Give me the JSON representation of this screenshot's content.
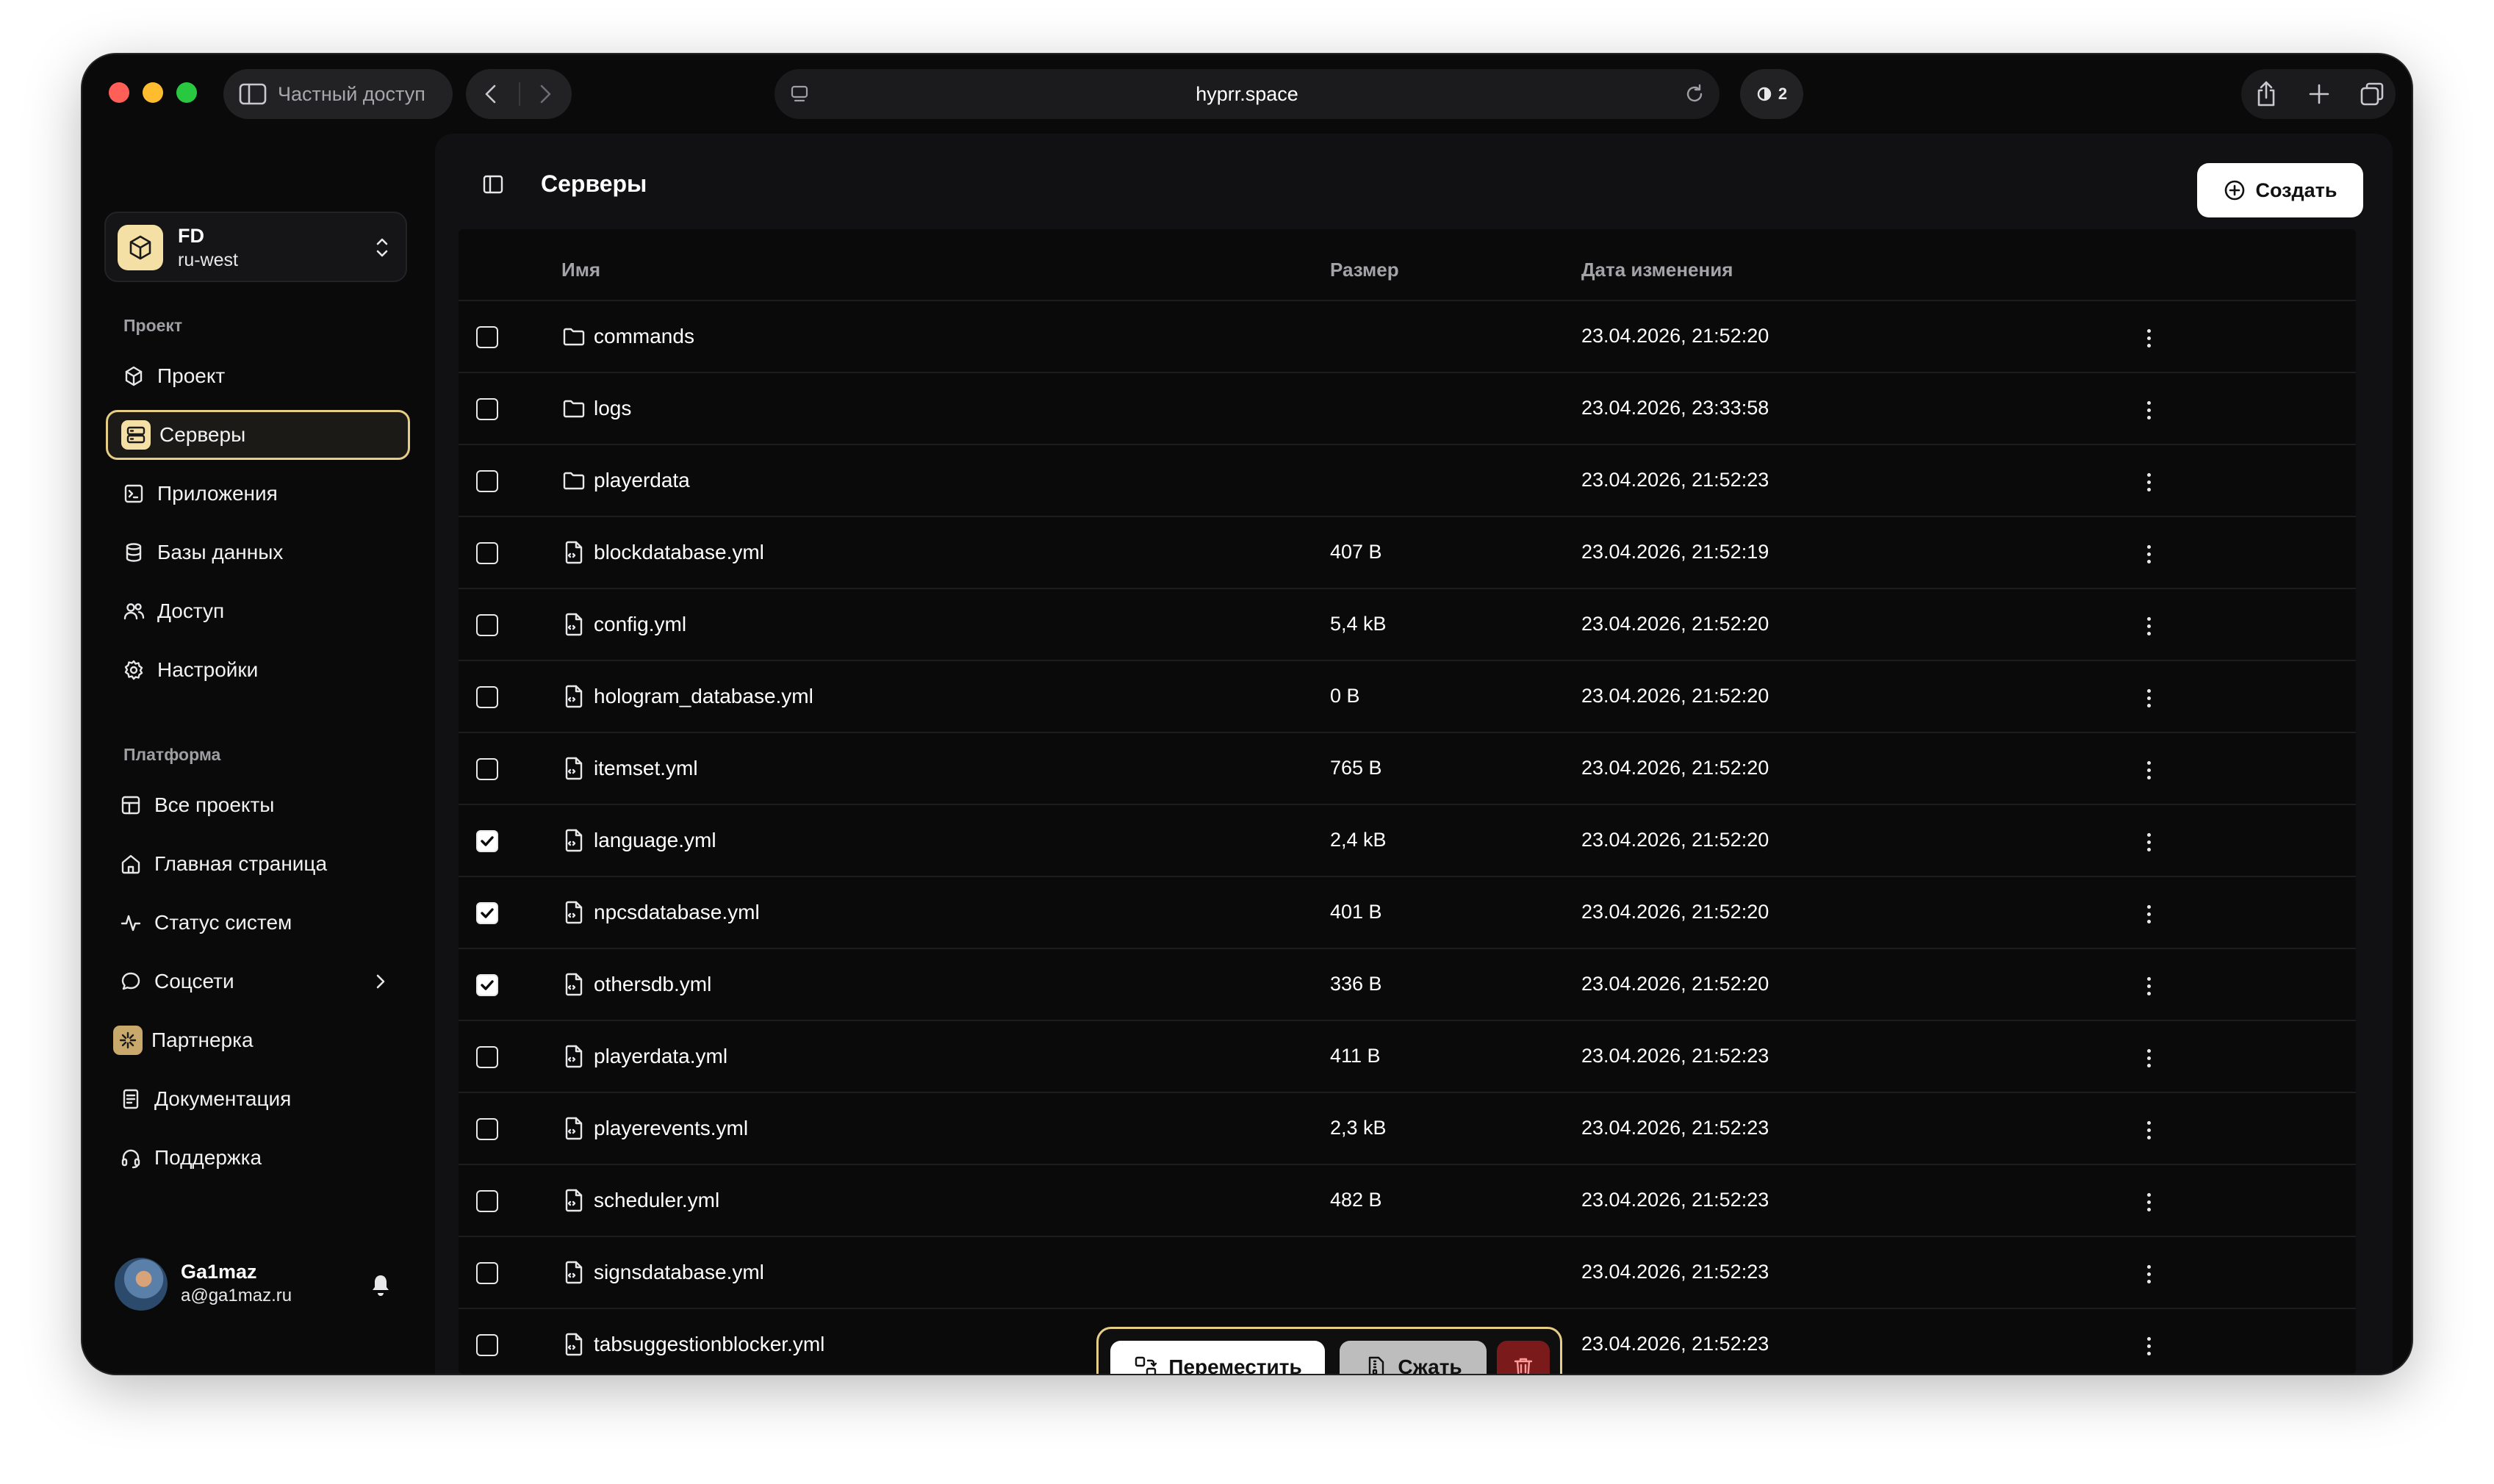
{
  "colors": {
    "accent": "#e6cd85",
    "accent_fill": "#f4dfa4",
    "danger": "#7a1a1a",
    "traffic_red": "#ff5f57",
    "traffic_yellow": "#febc2e",
    "traffic_green": "#28c840"
  },
  "browser": {
    "private_label": "Частный доступ",
    "url": "hyprr.space",
    "extension_badge": "2"
  },
  "sidebar": {
    "project": {
      "name": "FD",
      "region": "ru-west"
    },
    "section_project": "Проект",
    "project_items": [
      {
        "label": "Проект",
        "icon": "cube-icon"
      },
      {
        "label": "Серверы",
        "icon": "server-icon",
        "active": true
      },
      {
        "label": "Приложения",
        "icon": "terminal-window-icon"
      },
      {
        "label": "Базы данных",
        "icon": "database-icon"
      },
      {
        "label": "Доступ",
        "icon": "users-icon"
      },
      {
        "label": "Настройки",
        "icon": "gear-icon"
      }
    ],
    "section_platform": "Платформа",
    "platform_items": [
      {
        "label": "Все проекты",
        "icon": "grid-icon"
      },
      {
        "label": "Главная страница",
        "icon": "home-icon"
      },
      {
        "label": "Статус систем",
        "icon": "activity-icon"
      },
      {
        "label": "Соцсети",
        "icon": "chat-bubble-icon"
      },
      {
        "label": "Партнерка",
        "icon": "partner-icon"
      },
      {
        "label": "Документация",
        "icon": "document-icon"
      },
      {
        "label": "Поддержка",
        "icon": "headset-icon"
      }
    ],
    "user": {
      "name": "Ga1maz",
      "email": "a@ga1maz.ru"
    }
  },
  "main": {
    "title": "Серверы",
    "create_label": "Создать",
    "columns": {
      "name": "Имя",
      "size": "Размер",
      "modified": "Дата изменения"
    },
    "rows": [
      {
        "name": "commands",
        "type": "folder",
        "size": "",
        "modified": "23.04.2026, 21:52:20",
        "checked": false
      },
      {
        "name": "logs",
        "type": "folder",
        "size": "",
        "modified": "23.04.2026, 23:33:58",
        "checked": false
      },
      {
        "name": "playerdata",
        "type": "folder",
        "size": "",
        "modified": "23.04.2026, 21:52:23",
        "checked": false
      },
      {
        "name": "blockdatabase.yml",
        "type": "file",
        "size": "407 B",
        "modified": "23.04.2026, 21:52:19",
        "checked": false
      },
      {
        "name": "config.yml",
        "type": "file",
        "size": "5,4 kB",
        "modified": "23.04.2026, 21:52:20",
        "checked": false
      },
      {
        "name": "hologram_database.yml",
        "type": "file",
        "size": "0 B",
        "modified": "23.04.2026, 21:52:20",
        "checked": false
      },
      {
        "name": "itemset.yml",
        "type": "file",
        "size": "765 B",
        "modified": "23.04.2026, 21:52:20",
        "checked": false
      },
      {
        "name": "language.yml",
        "type": "file",
        "size": "2,4 kB",
        "modified": "23.04.2026, 21:52:20",
        "checked": true
      },
      {
        "name": "npcsdatabase.yml",
        "type": "file",
        "size": "401 B",
        "modified": "23.04.2026, 21:52:20",
        "checked": true
      },
      {
        "name": "othersdb.yml",
        "type": "file",
        "size": "336 B",
        "modified": "23.04.2026, 21:52:20",
        "checked": true
      },
      {
        "name": "playerdata.yml",
        "type": "file",
        "size": "411 B",
        "modified": "23.04.2026, 21:52:23",
        "checked": false
      },
      {
        "name": "playerevents.yml",
        "type": "file",
        "size": "2,3 kB",
        "modified": "23.04.2026, 21:52:23",
        "checked": false
      },
      {
        "name": "scheduler.yml",
        "type": "file",
        "size": "482 B",
        "modified": "23.04.2026, 21:52:23",
        "checked": false
      },
      {
        "name": "signsdatabase.yml",
        "type": "file",
        "size": "",
        "modified": "23.04.2026, 21:52:23",
        "checked": false
      },
      {
        "name": "tabsuggestionblocker.yml",
        "type": "file",
        "size": "",
        "modified": "23.04.2026, 21:52:23",
        "checked": false
      }
    ]
  },
  "action_bar": {
    "move_label": "Переместить",
    "compress_label": "Сжать"
  }
}
